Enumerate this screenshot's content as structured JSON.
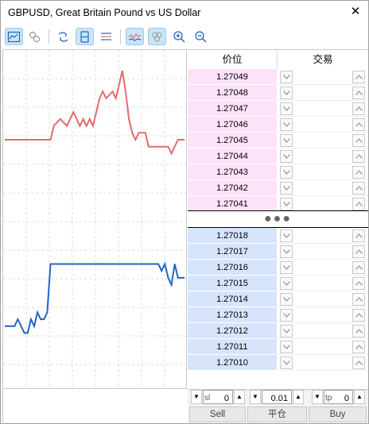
{
  "window": {
    "title": "GBPUSD, Great Britain Pound vs US Dollar",
    "close_symbol": "✕"
  },
  "toolbar": {
    "buttons": [
      {
        "name": "chart-icon",
        "active": true
      },
      {
        "name": "ticks-icon",
        "active": false
      },
      {
        "name": "depth-icon",
        "active": false
      },
      {
        "name": "volume-icon",
        "active": true
      },
      {
        "name": "trades-icon",
        "active": false
      },
      {
        "name": "tick-chart-icon",
        "active": true
      },
      {
        "name": "bubbles-icon",
        "active": true
      },
      {
        "name": "zoom-in-icon",
        "active": false
      },
      {
        "name": "zoom-out-icon",
        "active": false
      }
    ]
  },
  "book": {
    "header_price": "价位",
    "header_trade": "交易",
    "asks": [
      "1.27049",
      "1.27048",
      "1.27047",
      "1.27046",
      "1.27045",
      "1.27044",
      "1.27043",
      "1.27042",
      "1.27041"
    ],
    "spread_dots": "●●●",
    "bids": [
      "1.27018",
      "1.27017",
      "1.27016",
      "1.27015",
      "1.27014",
      "1.27013",
      "1.27012",
      "1.27011",
      "1.27010"
    ]
  },
  "panel": {
    "sl_label": "sl",
    "sl_value": "0",
    "volume_value": "0.01",
    "tp_label": "tp",
    "tp_value": "0",
    "sell_label": "Sell",
    "close_label": "平仓",
    "buy_label": "Buy"
  },
  "chart_data": {
    "type": "line",
    "series": [
      {
        "color": "#e06c6c",
        "points": [
          [
            0,
            1.27041
          ],
          [
            14,
            1.27041
          ],
          [
            15,
            1.27043
          ],
          [
            17,
            1.27044
          ],
          [
            19,
            1.27043
          ],
          [
            21,
            1.27045
          ],
          [
            22,
            1.27044
          ],
          [
            23,
            1.27043
          ],
          [
            24,
            1.27044
          ],
          [
            25,
            1.27043
          ],
          [
            26,
            1.27044
          ],
          [
            27,
            1.27043
          ],
          [
            29,
            1.27047
          ],
          [
            30,
            1.27048
          ],
          [
            31,
            1.27047
          ],
          [
            33,
            1.27048
          ],
          [
            34,
            1.27047
          ],
          [
            35,
            1.27049
          ],
          [
            36,
            1.27051
          ],
          [
            37,
            1.27048
          ],
          [
            38,
            1.27044
          ],
          [
            39,
            1.27042
          ],
          [
            40,
            1.27041
          ],
          [
            41,
            1.27042
          ],
          [
            43,
            1.27042
          ],
          [
            44,
            1.2704
          ],
          [
            50,
            1.2704
          ],
          [
            51,
            1.27039
          ],
          [
            52,
            1.2704
          ],
          [
            53,
            1.27041
          ],
          [
            55,
            1.27041
          ]
        ]
      },
      {
        "color": "#1f66c4",
        "points": [
          [
            0,
            1.27014
          ],
          [
            3,
            1.27014
          ],
          [
            4,
            1.27015
          ],
          [
            5,
            1.27014
          ],
          [
            6,
            1.27013
          ],
          [
            7,
            1.27013
          ],
          [
            8,
            1.27015
          ],
          [
            9,
            1.27014
          ],
          [
            10,
            1.27016
          ],
          [
            11,
            1.27015
          ],
          [
            12,
            1.27015
          ],
          [
            13,
            1.27016
          ],
          [
            14,
            1.27023
          ],
          [
            15,
            1.27023
          ],
          [
            47,
            1.27023
          ],
          [
            48,
            1.27022
          ],
          [
            49,
            1.27023
          ],
          [
            50,
            1.27021
          ],
          [
            51,
            1.2702
          ],
          [
            52,
            1.27023
          ],
          [
            53,
            1.27021
          ],
          [
            55,
            1.27021
          ]
        ]
      }
    ],
    "xlim": [
      0,
      55
    ],
    "ylim": [
      1.27005,
      1.27054
    ],
    "grid": true
  },
  "colors": {
    "ask_bg": "#fde3f9",
    "bid_bg": "#d6e5fb",
    "active_btn": "#cce4f7"
  }
}
